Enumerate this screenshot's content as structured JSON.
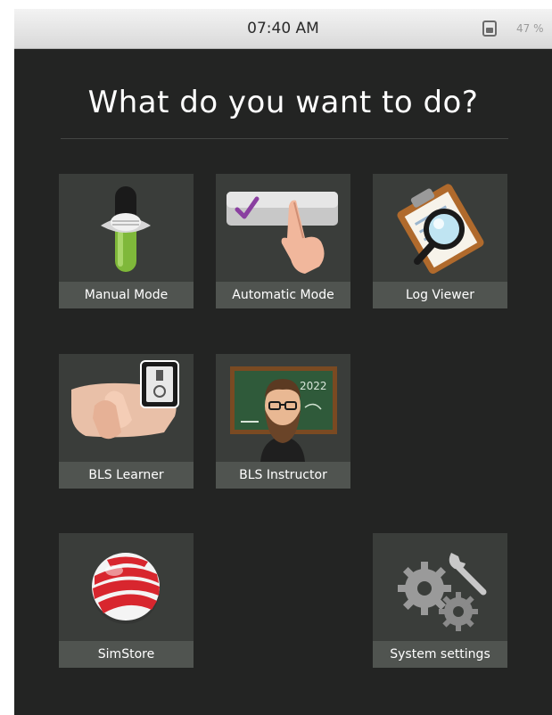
{
  "status_bar": {
    "time": "07:40 AM",
    "battery_percent": "47 %",
    "battery_icon": "battery-icon"
  },
  "main": {
    "title": "What do you want to do?"
  },
  "tiles": [
    {
      "label": "Manual Mode",
      "icon": "slider-toggle-icon"
    },
    {
      "label": "Automatic Mode",
      "icon": "touch-checkbox-icon"
    },
    {
      "label": "Log Viewer",
      "icon": "clipboard-magnifier-icon"
    },
    {
      "label": "BLS Learner",
      "icon": "cpr-hands-icon"
    },
    {
      "label": "BLS Instructor",
      "icon": "instructor-chalkboard-icon"
    },
    {
      "label": "SimStore",
      "icon": "simstore-sphere-icon"
    },
    {
      "label": "System settings",
      "icon": "gears-wrench-icon"
    }
  ],
  "colors": {
    "background": "#232423",
    "tile": "#3a3d3a",
    "tile_label_band": "#505450",
    "accent_green": "#7fb83a",
    "accent_red": "#d8262e"
  }
}
